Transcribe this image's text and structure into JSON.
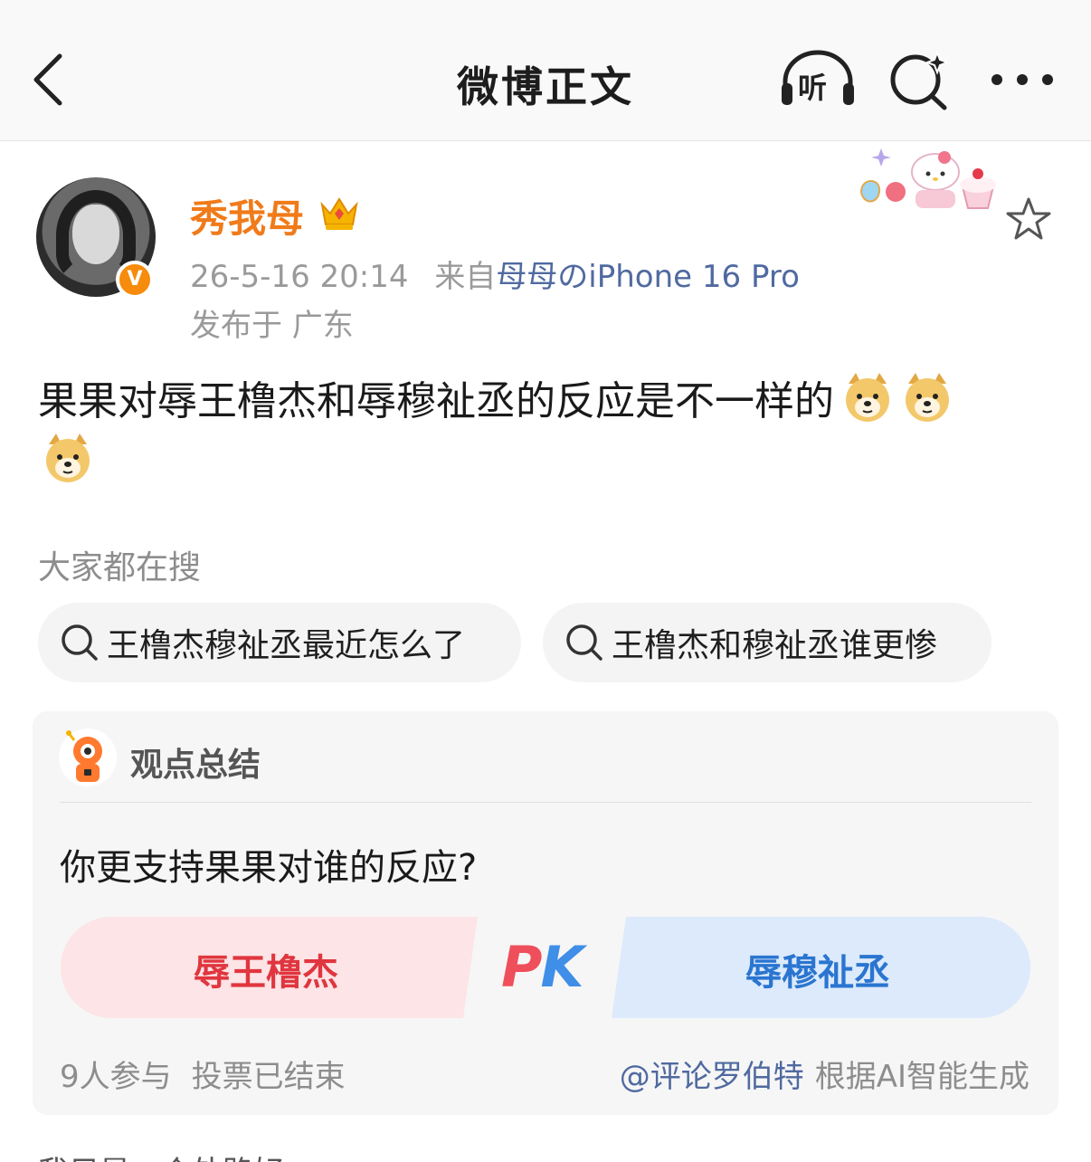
{
  "header": {
    "title": "微博正文",
    "listen_label": "听"
  },
  "post": {
    "username": "秀我母",
    "timestamp": "26-5-16 20:14",
    "from_prefix": "来自",
    "device": "母母のiPhone 16 Pro",
    "location": "发布于 广东",
    "text": "果果对辱王橹杰和辱穆祉丞的反应是不一样的",
    "emoji_count": 3,
    "verified_label": "V"
  },
  "hot_search": {
    "title": "大家都在搜",
    "chips": [
      "王橹杰穆祉丞最近怎么了",
      "王橹杰和穆祉丞谁更惨"
    ]
  },
  "summary_card": {
    "title": "观点总结",
    "question": "你更支持果果对谁的反应?",
    "option_left": "辱王橹杰",
    "option_right": "辱穆祉丞",
    "pk_p": "P",
    "pk_k": "K",
    "participants": "9人参与",
    "status": "投票已结束",
    "mention": "@评论罗伯特",
    "ai_note": "根据AI智能生成"
  },
  "next_text": "我只是一个外路好",
  "colors": {
    "username": "#f07b1a",
    "link": "#506aa0",
    "option_left": "#e0363f",
    "option_right": "#2a75d0",
    "verified": "#f78b0c"
  }
}
